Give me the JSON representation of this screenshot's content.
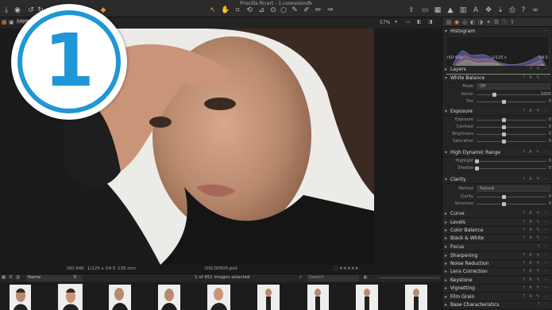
{
  "window": {
    "title": "Priscilla Ricart - 1.cosessiondb"
  },
  "viewer": {
    "zoom": "57%",
    "layer_tab": "Layers"
  },
  "info": {
    "iso": "ISO 640",
    "shutter": "1/125 s",
    "aperture": "f/4.5",
    "focal": "135 mm",
    "filename": "DSC00505.psd",
    "rating": "▢ ★★★★★"
  },
  "browser": {
    "sort": "Name",
    "count": "1 of 951 images selected",
    "search_placeholder": "Search"
  },
  "badge": {
    "number": "1"
  },
  "histogram": {
    "title": "Histogram",
    "iso": "ISO 640",
    "shutter": "1/125 s",
    "aperture": "f/4.5"
  },
  "tools": {
    "layers": "Layers",
    "white_balance": {
      "title": "White Balance",
      "mode_label": "Mode",
      "mode_value": "Off",
      "kelvin_label": "Kelvin",
      "kelvin_value": "5000",
      "tint_label": "Tint",
      "tint_value": "0"
    },
    "exposure": {
      "title": "Exposure",
      "rows": [
        {
          "label": "Exposure",
          "value": "0"
        },
        {
          "label": "Contrast",
          "value": "0"
        },
        {
          "label": "Brightness",
          "value": "0"
        },
        {
          "label": "Saturation",
          "value": "0"
        }
      ]
    },
    "hdr": {
      "title": "High Dynamic Range",
      "rows": [
        {
          "label": "Highlight",
          "value": "0"
        },
        {
          "label": "Shadow",
          "value": "0"
        }
      ]
    },
    "clarity": {
      "title": "Clarity",
      "method_label": "Method",
      "method_value": "Natural",
      "rows": [
        {
          "label": "Clarity",
          "value": "0"
        },
        {
          "label": "Structure",
          "value": "0"
        }
      ]
    },
    "collapsed": [
      "Curve",
      "Levels",
      "Color Balance",
      "Black & White",
      "Focus",
      "Sharpening",
      "Noise Reduction",
      "Lens Correction",
      "Keystone",
      "Vignetting",
      "Film Grain",
      "Base Characteristics"
    ]
  }
}
